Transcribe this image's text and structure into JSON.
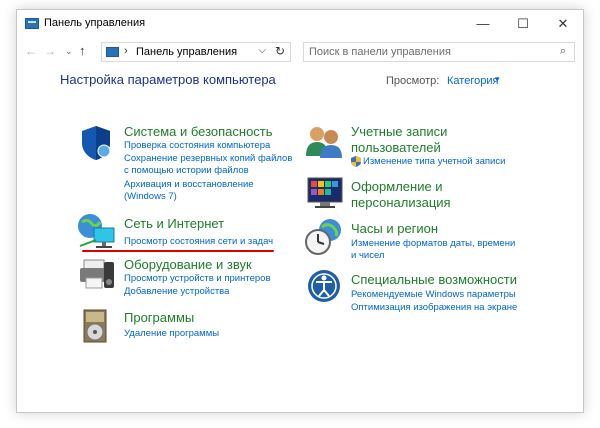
{
  "window": {
    "title": "Панель управления"
  },
  "titlebar": {
    "minimize": "—",
    "maximize": "☐",
    "close": "✕"
  },
  "nav": {
    "back": "←",
    "forward": "→",
    "history": "⌄",
    "up": "↑"
  },
  "address": {
    "separator": "›",
    "path": "Панель управления",
    "dropdown": "⌵",
    "refresh": "↻"
  },
  "search": {
    "placeholder": "Поиск в панели управления",
    "icon": "⌕"
  },
  "main": {
    "heading": "Настройка параметров компьютера",
    "view_by_label": "Просмотр:",
    "view_by_value": "Категория",
    "view_by_arrow": "▾"
  },
  "categories": [
    {
      "title": "Система и безопасность",
      "icon": "shield-icon",
      "links": [
        "Проверка состояния компьютера",
        "Сохранение резервных копий файлов",
        "с помощью истории файлов",
        "Архивация и восстановление",
        "(Windows 7)"
      ]
    },
    {
      "title": "Сеть и Интернет",
      "icon": "network-icon",
      "links": [
        "Просмотр состояния сети и задач"
      ]
    },
    {
      "title": "Оборудование и звук",
      "icon": "printer-icon",
      "links": [
        "Просмотр устройств и принтеров",
        "Добавление устройства"
      ]
    },
    {
      "title": "Программы",
      "icon": "programs-icon",
      "links": [
        "Удаление программы"
      ]
    },
    {
      "title_line1": "Учетные записи",
      "title_line2": "пользователей",
      "icon": "users-icon",
      "links": [
        "Изменение типа учетной записи"
      ]
    },
    {
      "title_line1": "Оформление и",
      "title_line2": "персонализация",
      "icon": "appearance-icon",
      "links": []
    },
    {
      "title": "Часы и регион",
      "icon": "clock-icon",
      "links": [
        "Изменение форматов даты, времени",
        "и чисел"
      ]
    },
    {
      "title": "Специальные возможности",
      "icon": "accessibility-icon",
      "links": [
        "Рекомендуемые Windows параметры",
        "Оптимизация изображения на экране"
      ]
    }
  ],
  "colors": {
    "heading": "#1e3287",
    "category": "#1e7d2a",
    "link": "#0066cc",
    "highlight": "#e00000"
  }
}
